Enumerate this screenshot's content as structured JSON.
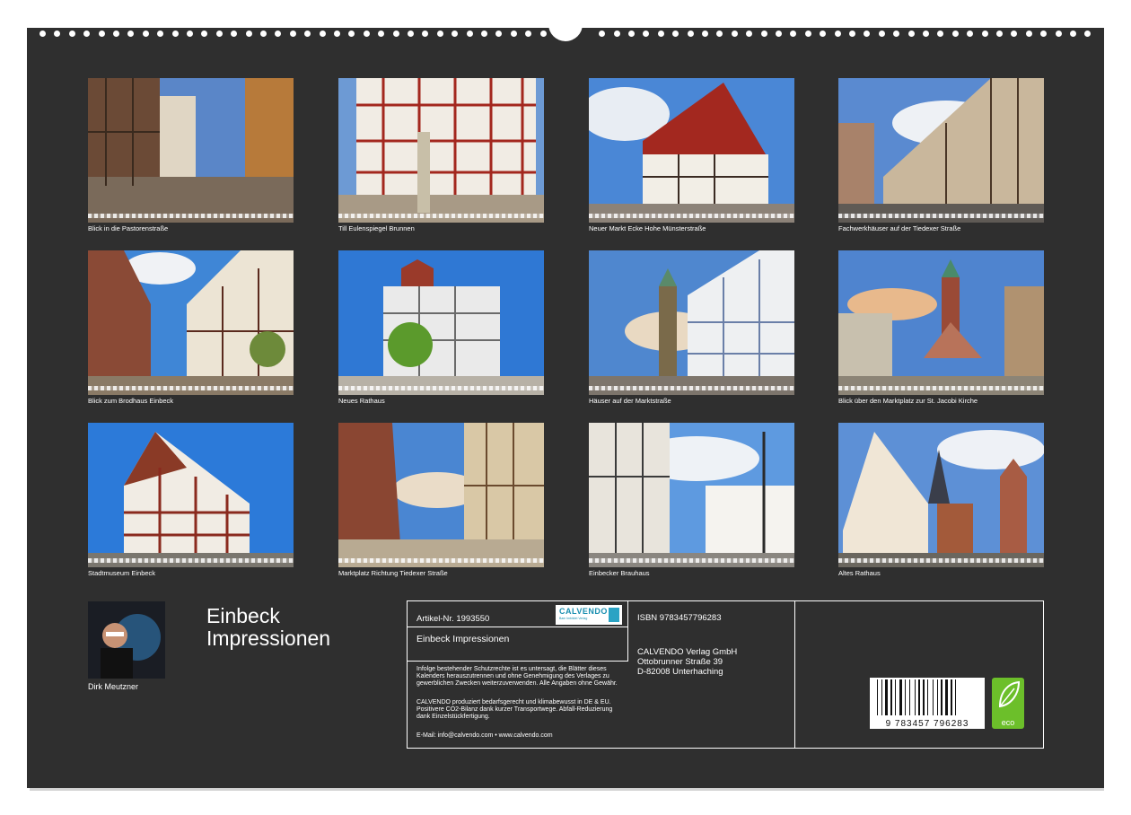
{
  "calendar": {
    "title_line1": "Einbeck",
    "title_line2": "Impressionen",
    "author": "Dirk Meutzner"
  },
  "months": [
    {
      "caption": "Blick in die Pastorenstraße"
    },
    {
      "caption": "Till Eulenspiegel Brunnen"
    },
    {
      "caption": "Neuer Markt Ecke Hohe Münsterstraße"
    },
    {
      "caption": "Fachwerkhäuser auf der Tiedexer Straße"
    },
    {
      "caption": "Blick zum Brodhaus Einbeck"
    },
    {
      "caption": "Neues Rathaus"
    },
    {
      "caption": "Häuser auf der Marktstraße"
    },
    {
      "caption": "Blick über den Marktplatz zur St. Jacobi Kirche"
    },
    {
      "caption": "Stadtmuseum Einbeck"
    },
    {
      "caption": "Marktplatz Richtung Tiedexer Straße"
    },
    {
      "caption": "Einbecker Brauhaus"
    },
    {
      "caption": "Altes Rathaus"
    }
  ],
  "info": {
    "article": "Artikel-Nr. 1993550",
    "logo": "CALVENDO",
    "logo_sub": "Bam Imbildet Verlag",
    "product_title": "Einbeck Impressionen",
    "legal_1": "Infolge bestehender Schutzrechte ist es untersagt, die Blätter dieses Kalenders herauszutrennen und ohne Genehmigung des Verlages zu gewerblichen Zwecken weiterzuverwenden. Alle Angaben ohne Gewähr.",
    "legal_2": "CALVENDO produziert bedarfsgerecht und klimabewusst in DE & EU. Positivere CO2-Bilanz dank kurzer Transportwege. Abfall-Reduzierung dank Einzelstückfertigung.",
    "contact": "E-Mail: info@calvendo.com • www.calvendo.com",
    "isbn": "ISBN 9783457796283",
    "publisher_1": "CALVENDO Verlag GmbH",
    "publisher_2": "Ottobrunner Straße 39",
    "publisher_3": "D-82008 Unterhaching",
    "barcode_digits": "9 783457 796283",
    "eco_label": "eco"
  },
  "colors": {
    "background": "#2f2f2f",
    "timber_red": "#9a2a24",
    "sky_blue": "#3f7fd0"
  }
}
